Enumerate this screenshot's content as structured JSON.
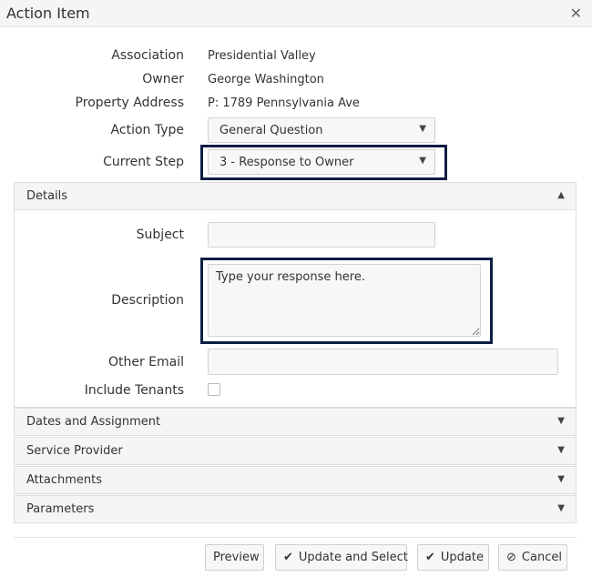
{
  "dialog": {
    "title": "Action Item",
    "close_glyph": "✕"
  },
  "fields": {
    "association": {
      "label": "Association",
      "value": "Presidential Valley"
    },
    "owner": {
      "label": "Owner",
      "value": "George Washington"
    },
    "property_address": {
      "label": "Property Address",
      "value": "P: 1789 Pennsylvania Ave"
    },
    "action_type": {
      "label": "Action Type",
      "value": "General Question"
    },
    "current_step": {
      "label": "Current Step",
      "value": "3 - Response to Owner"
    }
  },
  "details": {
    "header": "Details",
    "subject": {
      "label": "Subject",
      "value": ""
    },
    "description": {
      "label": "Description",
      "placeholder": "Type your response here."
    },
    "other_email": {
      "label": "Other Email",
      "value": ""
    },
    "include_tenants": {
      "label": "Include Tenants",
      "checked": false
    }
  },
  "sections": {
    "dates": "Dates and Assignment",
    "service_provider": "Service Provider",
    "attachments": "Attachments",
    "parameters": "Parameters"
  },
  "buttons": {
    "preview": "Preview",
    "update_select": "Update and Select",
    "update": "Update",
    "cancel": "Cancel"
  },
  "icons": {
    "close": "close-icon",
    "dropdown": "chevron-down-icon",
    "collapse": "chevron-up-icon",
    "check": "check-icon",
    "cancel": "ban-icon"
  },
  "colors": {
    "highlight_border": "#0e1e45",
    "header_bg": "#f5f5f5",
    "input_bg": "#f7f7f7"
  }
}
